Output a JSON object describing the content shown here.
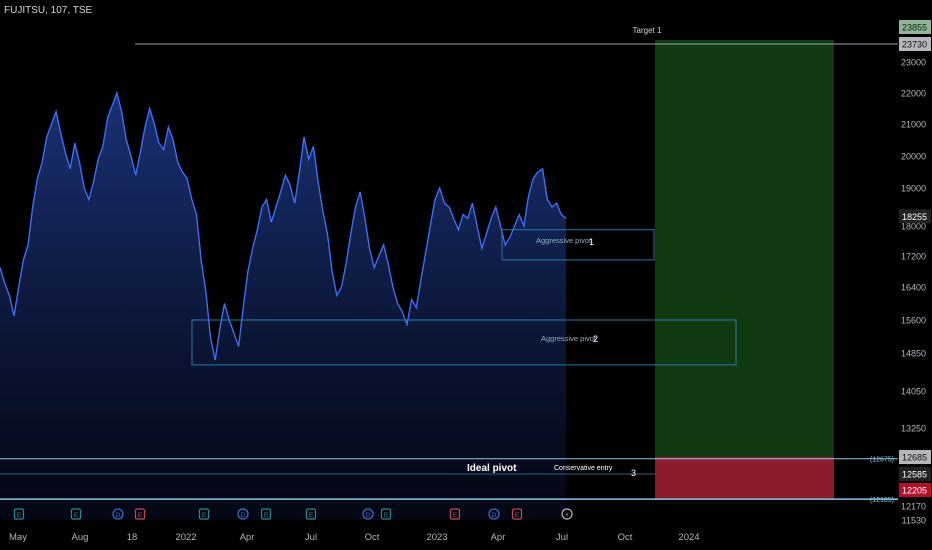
{
  "symbol_label": "FUJITSU, 107, TSE",
  "colors": {
    "line": "#3d6ef5",
    "fill_top": "#1e3a8a",
    "target_zone": "#0f3a12",
    "stop_zone": "#8b1a2b",
    "pivot_box": "#2a7aa6",
    "axis_text": "#b2b5be"
  },
  "chart_data": {
    "type": "area",
    "ylim": [
      11530,
      23900
    ],
    "x_labels": [
      "May",
      "Aug",
      "18",
      "2022",
      "Apr",
      "Jul",
      "Oct",
      "2023",
      "Apr",
      "Jul",
      "Oct",
      "2024"
    ],
    "y_ticks": [
      "23000",
      "22000",
      "21000",
      "20000",
      "19000",
      "18000",
      "17200",
      "16400",
      "15600",
      "14850",
      "14050",
      "13250",
      "12170",
      "11530"
    ],
    "price_tags": [
      {
        "label": "23855",
        "value": 23855,
        "style": "green-light"
      },
      {
        "label": "23730",
        "value": 23730,
        "style": "gray"
      },
      {
        "label": "18255",
        "value": 18255,
        "style": "dark"
      },
      {
        "label": "12685",
        "value": 12685,
        "style": "gray"
      },
      {
        "label": "12585",
        "value": 12585,
        "style": "dark"
      },
      {
        "label": "12205",
        "value": 12205,
        "style": "red"
      }
    ],
    "paren_labels": [
      {
        "label": "(12675)",
        "value": 12675
      },
      {
        "label": "(12185)",
        "value": 12185
      }
    ],
    "series": [
      {
        "values": [
          16900,
          16500,
          16200,
          15700,
          16400,
          17100,
          17500,
          18500,
          19300,
          19800,
          20600,
          21000,
          21400,
          20700,
          20100,
          19600,
          20400,
          19800,
          19000,
          18700,
          19200,
          19900,
          20300,
          21200,
          21600,
          22000,
          21400,
          20500,
          20000,
          19400,
          20100,
          20900,
          21500,
          21000,
          20400,
          20200,
          20900,
          20500,
          19800,
          19500,
          19300,
          18700,
          18300,
          17100,
          16300,
          15200,
          14700,
          15400,
          16000,
          15600,
          15300,
          15000,
          15900,
          16800,
          17400,
          17900,
          18500,
          18700,
          18100,
          18500,
          18900,
          19400,
          19100,
          18600,
          19500,
          20600,
          19900,
          20300,
          19200,
          18400,
          17800,
          16800,
          16200,
          16400,
          17000,
          17800,
          18500,
          18900,
          18200,
          17400,
          16900,
          17200,
          17500,
          17000,
          16400,
          16000,
          15800,
          15500,
          16100,
          15900,
          16600,
          17300,
          18000,
          18700,
          19000,
          18600,
          18500,
          18200,
          17900,
          18300,
          18200,
          18600,
          18000,
          17400,
          17800,
          18200,
          18500,
          18000,
          17500,
          17700,
          18000,
          18300,
          18000,
          18800,
          19300,
          19500,
          19600,
          18700,
          18500,
          18600,
          18300,
          18200
        ]
      }
    ],
    "annotations": {
      "target": {
        "label": "Target 1",
        "value": 23730
      },
      "pivot1": {
        "label": "Aggressive pivot",
        "num": "1",
        "top": 17900,
        "bottom": 17100
      },
      "pivot2": {
        "label": "Aggressive pivot",
        "num": "2",
        "top": 15600,
        "bottom": 14600
      },
      "ideal": {
        "label": "Ideal pivot"
      },
      "conservative": {
        "label": "Conservative entry",
        "num": "3"
      }
    },
    "event_markers": [
      "E",
      "E",
      "D",
      "E",
      "E",
      "D",
      "E",
      "E",
      "D",
      "E",
      "E",
      "D",
      "E",
      "S"
    ]
  }
}
